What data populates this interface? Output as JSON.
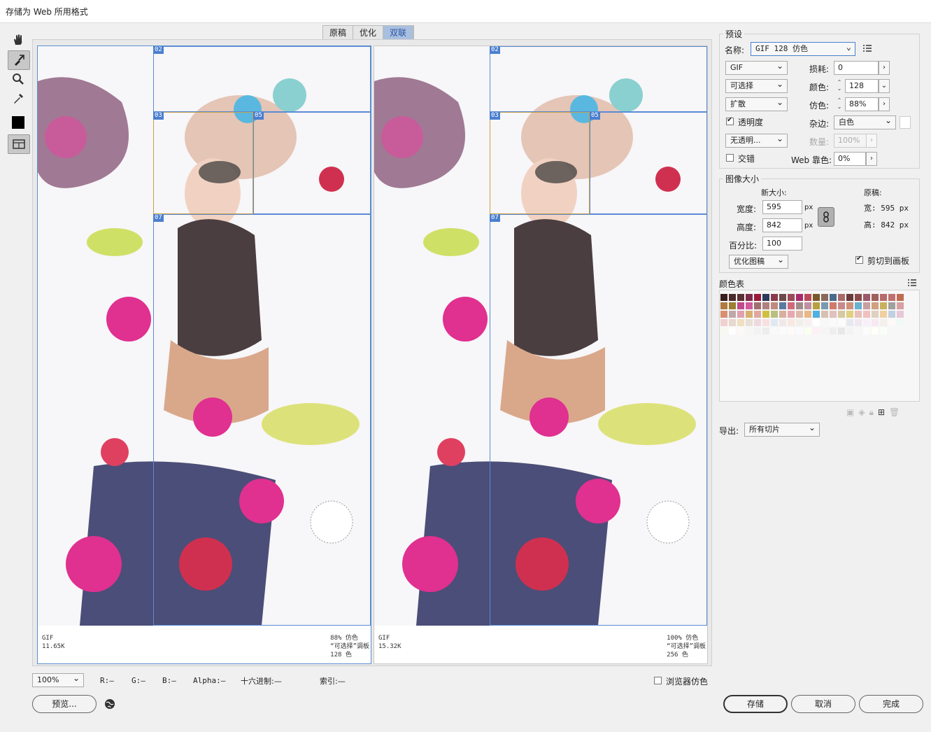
{
  "window": {
    "title": "存储为 Web 所用格式"
  },
  "view_tabs": [
    "原稿",
    "优化",
    "双联"
  ],
  "selected_tab": "双联",
  "tools": [
    "hand-icon",
    "slice-select-icon",
    "zoom-icon",
    "eyedropper-icon",
    "color-swatch-icon",
    "slice-visibility-icon"
  ],
  "slices": {
    "a": "02",
    "b": "03",
    "c": "05",
    "d": "07"
  },
  "left_panel": {
    "format": "GIF",
    "size": "11.65K",
    "dither": "88% 仿色",
    "palette": "“可选择”调板",
    "colors": "128 色"
  },
  "right_panel": {
    "format": "GIF",
    "size": "15.32K",
    "dither": "100% 仿色",
    "palette": "“可选择”调板",
    "colors": "256 色"
  },
  "status": {
    "zoom": "100%",
    "r": "R:—",
    "g": "G:—",
    "b": "B:—",
    "alpha": "Alpha:—",
    "hex": "十六进制:—",
    "index": "索引:—",
    "browser_dither": "浏览器仿色"
  },
  "buttons": {
    "preview": "预览...",
    "save": "存储",
    "cancel": "取消",
    "done": "完成"
  },
  "preset": {
    "group_title": "预设",
    "name_label": "名称:",
    "name_value": "GIF 128 仿色",
    "format": "GIF",
    "lossy_label": "损耗:",
    "lossy_value": "0",
    "reduction": "可选择",
    "colors_label": "颜色:",
    "colors_value": "128",
    "dither_algo": "扩散",
    "dither_label": "仿色:",
    "dither_value": "88%",
    "transparency_label": "透明度",
    "transparency_checked": true,
    "matte_label": "杂边:",
    "matte_value": "白色",
    "trans_dither": "无透明...",
    "amount_label": "数量:",
    "amount_value": "100%",
    "interlaced_label": "交错",
    "interlaced_checked": false,
    "websnap_label": "Web 靠色:",
    "websnap_value": "0%"
  },
  "image_size": {
    "group_title": "图像大小",
    "new_size_label": "新大小:",
    "original_label": "原稿:",
    "width_label": "宽度:",
    "width_value": "595",
    "height_label": "高度:",
    "height_value": "842",
    "unit": "px",
    "percent_label": "百分比:",
    "percent_value": "100",
    "orig_width": "宽: 595 px",
    "orig_height": "高: 842 px",
    "quality": "优化图稿",
    "clip_label": "剪切到画板",
    "clip_checked": true
  },
  "color_table": {
    "title": "颜色表",
    "colors": [
      "#3a1e1e",
      "#4a2a2a",
      "#5a3030",
      "#7a2a4a",
      "#9a1a3a",
      "#2a3a5a",
      "#8a3a4a",
      "#6a4a4a",
      "#9a4a5a",
      "#aa2a6a",
      "#ba4a5a",
      "#7a5a2a",
      "#8a6a5a",
      "#4a6a8a",
      "#aa6a6a",
      "#6a3a3a",
      "#8a4a4a",
      "#9a5a6a",
      "#a0605a",
      "#b86a6a",
      "#c07070",
      "#c06a50",
      "#b07a40",
      "#9a8030",
      "#c04a8a",
      "#d05a9a",
      "#a07070",
      "#b08080",
      "#c08a80",
      "#5a7aa0",
      "#d06a7a",
      "#a08a8a",
      "#c090a0",
      "#b8a040",
      "#7a9ab0",
      "#d07a6a",
      "#c88a8a",
      "#d0907a",
      "#6ab0d0",
      "#c8a0a0",
      "#d0a080",
      "#c8b060",
      "#a0a0a0",
      "#d8a0a0",
      "#d89070",
      "#c0a8a8",
      "#e0a0b0",
      "#d8b070",
      "#e0a8a0",
      "#d0c040",
      "#b8c080",
      "#d8b0a0",
      "#e8a8b0",
      "#e0b8a8",
      "#e8b888",
      "#50b0e0",
      "#d8c0b0",
      "#e0c0c0",
      "#d8c8a0",
      "#e0d080",
      "#e8c0b8",
      "#f0c0c0",
      "#e0d0c0",
      "#f0d0a0",
      "#c0d0e0",
      "#e8c8d8",
      "#f0d0d0",
      "#e8d8d0",
      "#f0e0c0",
      "#e8e0d8",
      "#f0d8e0",
      "#f8e0e0",
      "#e0e8f0",
      "#f0e8e8",
      "#f8e8e0",
      "#f0f0e8",
      "#f8f0f0",
      "#ffffff",
      "#f8f8f8",
      "#fafafa",
      "#fcfcfc",
      "#e8e8f0",
      "#f0e8f0",
      "#f8f0f8",
      "#f8e8f0",
      "#f4f0ec",
      "#fff8f8",
      "#f0f8f8",
      "#f8f8f0",
      "#fefefe",
      "#fdf8f8",
      "#f6f6f6",
      "#f2f2f2",
      "#ededed",
      "#f9f9f9",
      "#fbfbfb",
      "#fffafa",
      "#fafaff",
      "#fafff0",
      "#fff0f5",
      "#f5f5f5",
      "#eeeeee",
      "#e8e8e8",
      "#f3f3f3",
      "#f7f7f7",
      "#fcfcfc",
      "#fffff8",
      "#f8fff8"
    ]
  },
  "export": {
    "label": "导出:",
    "value": "所有切片"
  }
}
